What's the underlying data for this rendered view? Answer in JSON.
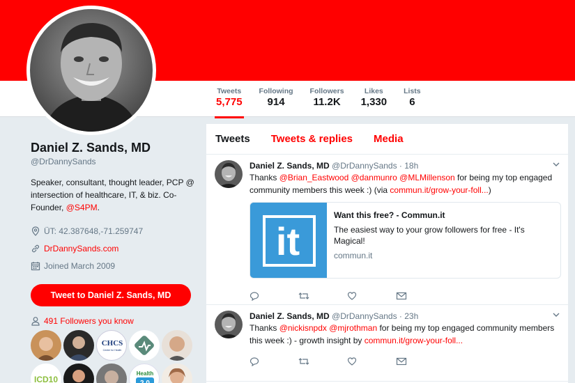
{
  "colors": {
    "accent": "#ff0000",
    "banner": "#ff0000",
    "background": "#e6ecf0",
    "muted": "#657786"
  },
  "nav": {
    "stats": [
      {
        "label": "Tweets",
        "value": "5,775",
        "active": true
      },
      {
        "label": "Following",
        "value": "914"
      },
      {
        "label": "Followers",
        "value": "11.2K"
      },
      {
        "label": "Likes",
        "value": "1,330"
      },
      {
        "label": "Lists",
        "value": "6"
      }
    ]
  },
  "profile": {
    "name": "Daniel Z. Sands, MD",
    "handle": "@DrDannySands",
    "bio_text": "Speaker, consultant, thought leader, PCP @ intersection of healthcare, IT, & biz. Co-Founder, ",
    "bio_link": "@S4PM",
    "bio_end": ".",
    "location": "ÜT: 42.387648,-71.259747",
    "website": "DrDannySands.com",
    "joined": "Joined March 2009",
    "tweet_button": "Tweet to Daniel Z. Sands, MD",
    "followers_you_know": "491 Followers you know"
  },
  "tabs": [
    "Tweets",
    "Tweets & replies",
    "Media"
  ],
  "tweets": [
    {
      "name": "Daniel Z. Sands, MD",
      "meta": "@DrDannySands · 18h",
      "text_1": "Thanks ",
      "mention_1": "@Brian_Eastwood",
      "mention_2": "@danmunro",
      "mention_3": "@MLMillenson",
      "text_2": " for being my top engaged community members this week :) (via ",
      "link": "commun.it/grow-your-foll...",
      "text_3": ")",
      "card": {
        "title": "Want this free? - Commun.it",
        "description": "The easiest way to your grow followers for free - It's Magical!",
        "domain": "commun.it",
        "logo_text": "it"
      }
    },
    {
      "name": "Daniel Z. Sands, MD",
      "meta": "@DrDannySands · 23h",
      "text_1": "Thanks ",
      "mention_1": "@nickisnpdx",
      "mention_2": "@mjrothman",
      "text_2": " for being my top engaged community members this week :) - growth insight by ",
      "link": "commun.it/grow-your-foll..."
    }
  ],
  "faces": [
    {
      "label": "",
      "color": "#c9925a"
    },
    {
      "label": "",
      "color": "#2a2a2a"
    },
    {
      "label": "CHCS",
      "color": "#ffffff"
    },
    {
      "label": "",
      "color": "#5a8a7a"
    },
    {
      "label": "",
      "color": "#d5a888"
    },
    {
      "label": "ICD10",
      "color": "#8dbf3f"
    },
    {
      "label": "",
      "color": "#b0302a"
    },
    {
      "label": "",
      "color": "#555555"
    },
    {
      "label": "Health 2.0",
      "color": "#ffffff"
    },
    {
      "label": "",
      "color": "#a06a48"
    }
  ]
}
